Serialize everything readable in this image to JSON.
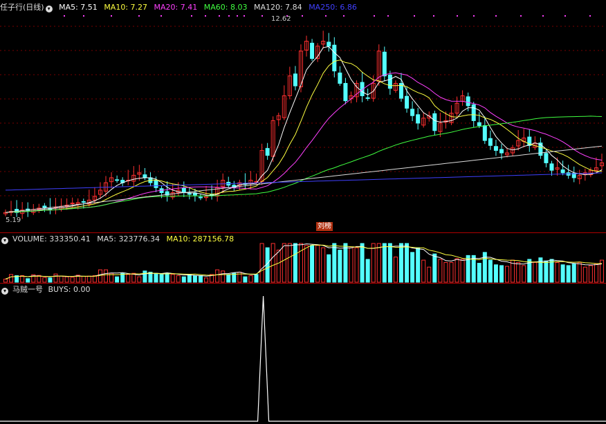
{
  "main": {
    "title": "任子行(日线)",
    "ma": [
      {
        "label": "MA5: 7.51",
        "color": "#ffffff"
      },
      {
        "label": "MA10: 7.27",
        "color": "#ffff40"
      },
      {
        "label": "MA20: 7.41",
        "color": "#ff40ff"
      },
      {
        "label": "MA60: 8.03",
        "color": "#40ff40"
      },
      {
        "label": "MA120: 7.84",
        "color": "#dddddd"
      },
      {
        "label": "MA250: 6.86",
        "color": "#4040ff"
      }
    ],
    "high_label": "12.62",
    "low_label": "5.19",
    "badge": "刘榜"
  },
  "volume": {
    "title": "VOLUME: 333350.41",
    "ma5": "MA5: 323776.34",
    "ma10": "MA10: 287156.78"
  },
  "indicator": {
    "title": "马贼一号",
    "value": "BUYS: 0.00"
  },
  "chart_data": {
    "type": "candlestick",
    "series_colors": {
      "up": "#ff3030",
      "down": "#54ffff",
      "ma5": "#ffffff",
      "ma10": "#ffff40",
      "ma20": "#ff40ff",
      "ma60": "#40ff40",
      "ma120": "#dddddd",
      "ma250": "#4040ff"
    },
    "price_range": [
      5.0,
      13.3
    ],
    "closes": [
      5.3,
      5.35,
      5.3,
      5.4,
      5.38,
      5.42,
      5.48,
      5.5,
      5.45,
      5.52,
      5.55,
      5.6,
      5.68,
      5.7,
      5.72,
      5.8,
      5.95,
      6.2,
      6.5,
      6.7,
      6.6,
      6.5,
      6.6,
      6.8,
      6.9,
      6.7,
      6.5,
      6.3,
      6.1,
      6.0,
      6.1,
      6.2,
      6.1,
      6.05,
      6.0,
      5.9,
      5.95,
      6.0,
      6.3,
      6.6,
      6.4,
      6.3,
      6.5,
      6.45,
      6.6,
      6.55,
      7.8,
      7.6,
      9.0,
      9.2,
      10.0,
      10.8,
      10.4,
      11.8,
      12.2,
      11.5,
      12.0,
      12.2,
      12.0,
      11.0,
      10.5,
      9.8,
      10.0,
      10.5,
      10.0,
      9.9,
      10.5,
      11.8,
      10.8,
      10.3,
      10.5,
      9.9,
      9.5,
      9.2,
      8.9,
      9.1,
      9.2,
      8.6,
      8.9,
      9.0,
      9.3,
      9.7,
      10.0,
      9.6,
      9.0,
      8.8,
      8.2,
      8.0,
      7.8,
      7.7,
      7.7,
      7.9,
      8.2,
      8.3,
      8.0,
      8.1,
      7.6,
      7.3,
      7.0,
      7.1,
      6.9,
      6.8,
      6.7,
      6.8,
      6.9,
      7.0,
      7.1,
      7.3
    ]
  }
}
